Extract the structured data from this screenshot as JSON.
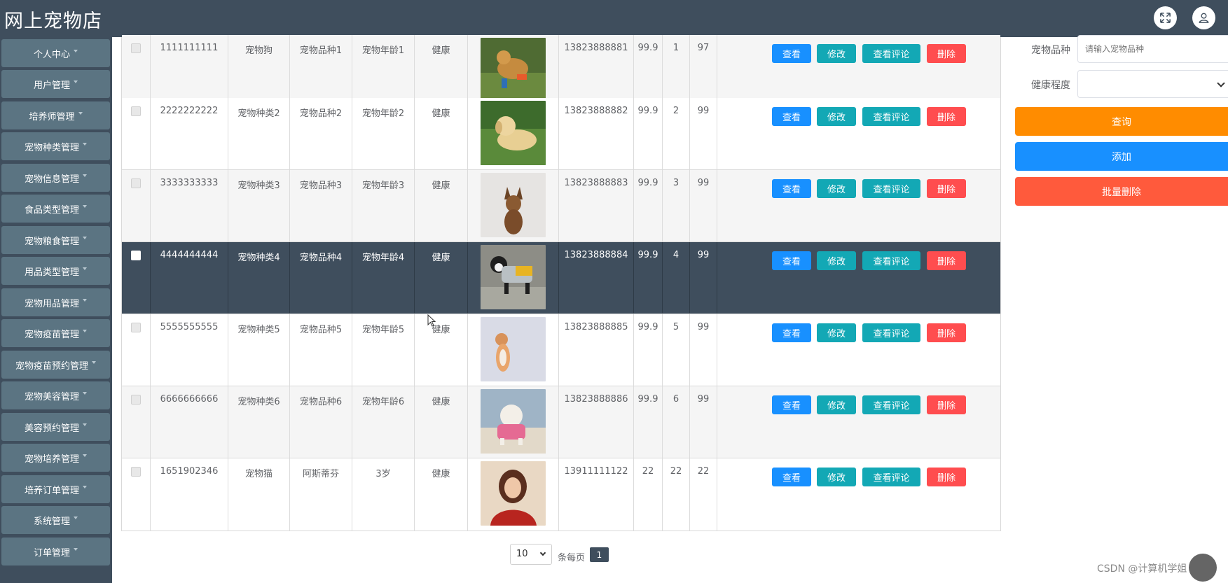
{
  "app": {
    "title": "网上宠物店"
  },
  "topbar": {
    "fullscreen_icon": "expand-icon",
    "user_icon": "user-icon"
  },
  "sidebar": {
    "items": [
      {
        "label": "个人中心"
      },
      {
        "label": "用户管理"
      },
      {
        "label": "培养师管理"
      },
      {
        "label": "宠物种类管理"
      },
      {
        "label": "宠物信息管理"
      },
      {
        "label": "食品类型管理"
      },
      {
        "label": "宠物粮食管理"
      },
      {
        "label": "用品类型管理"
      },
      {
        "label": "宠物用品管理"
      },
      {
        "label": "宠物疫苗管理"
      },
      {
        "label": "宠物疫苗预约管理"
      },
      {
        "label": "宠物美容管理"
      },
      {
        "label": "美容预约管理"
      },
      {
        "label": "宠物培养管理"
      },
      {
        "label": "培养订单管理"
      },
      {
        "label": "系统管理"
      },
      {
        "label": "订单管理"
      }
    ]
  },
  "table": {
    "actions": {
      "view": "查看",
      "edit": "修改",
      "review": "查看评论",
      "delete": "删除"
    },
    "rows": [
      {
        "id": "1111111111",
        "type": "宠物狗",
        "breed": "宠物品种1",
        "age": "宠物年龄1",
        "health": "健康",
        "phone": "13823888881",
        "price": "99.9",
        "n1": "1",
        "n2": "97",
        "image": "dog-golden-grass"
      },
      {
        "id": "2222222222",
        "type": "宠物种类2",
        "breed": "宠物品种2",
        "age": "宠物年龄2",
        "health": "健康",
        "phone": "13823888882",
        "price": "99.9",
        "n1": "2",
        "n2": "99",
        "image": "dog-puppy-lab"
      },
      {
        "id": "3333333333",
        "type": "宠物种类3",
        "breed": "宠物品种3",
        "age": "宠物年龄3",
        "health": "健康",
        "phone": "13823888883",
        "price": "99.9",
        "n1": "3",
        "n2": "99",
        "image": "dog-shepherd"
      },
      {
        "id": "4444444444",
        "type": "宠物种类4",
        "breed": "宠物品种4",
        "age": "宠物年龄4",
        "health": "健康",
        "phone": "13823888884",
        "price": "99.9",
        "n1": "4",
        "n2": "99",
        "image": "dog-costume"
      },
      {
        "id": "5555555555",
        "type": "宠物种类5",
        "breed": "宠物品种5",
        "age": "宠物年龄5",
        "health": "健康",
        "phone": "13823888885",
        "price": "99.9",
        "n1": "5",
        "n2": "99",
        "image": "cat-sitting"
      },
      {
        "id": "6666666666",
        "type": "宠物种类6",
        "breed": "宠物品种6",
        "age": "宠物年龄6",
        "health": "健康",
        "phone": "13823888886",
        "price": "99.9",
        "n1": "6",
        "n2": "99",
        "image": "dog-poodle-pink"
      },
      {
        "id": "1651902346",
        "type": "宠物猫",
        "breed": "阿斯蒂芬",
        "age": "3岁",
        "health": "健康",
        "phone": "13911111122",
        "price": "22",
        "n1": "22",
        "n2": "22",
        "image": "portrait-red"
      }
    ]
  },
  "search": {
    "breed_label": "宠物品种",
    "breed_placeholder": "请输入宠物品种",
    "health_label": "健康程度",
    "health_value": "",
    "query_button": "查询",
    "add_button": "添加",
    "batch_delete_button": "批量删除"
  },
  "pagination": {
    "page_size": "10",
    "per_page_label": "条每页",
    "current_page": "1"
  },
  "watermark": "CSDN @计算机学姐",
  "colors": {
    "header": "#3f4e5d",
    "menu_item": "#5b7482",
    "primary": "#1890ff",
    "teal": "#13a8b5",
    "danger": "#ff4d4f",
    "orange": "#ff8c00",
    "batch_delete": "#ff5a3c",
    "selected_row": "#3f4e5d"
  }
}
